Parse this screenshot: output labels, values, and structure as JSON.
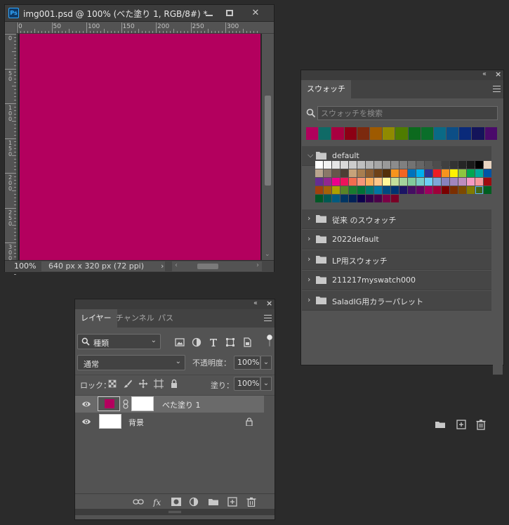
{
  "document": {
    "title": "img001.psd @ 100% (べた塗り 1, RGB/8#) *",
    "app_icon": "Ps",
    "fill_color": "#b3005e",
    "ruler_h_labels": [
      "0",
      "50",
      "100",
      "150",
      "200",
      "250",
      "300"
    ],
    "ruler_v_labels": [
      "0",
      "50",
      "100",
      "150",
      "200",
      "250",
      "300"
    ],
    "zoom": "100%",
    "doc_info": "640 px x 320 px (72 ppi)"
  },
  "swatches": {
    "tab_label": "スウォッチ",
    "search_placeholder": "スウォッチを検索",
    "recent": [
      "#b0005c",
      "#0f6a66",
      "#a80040",
      "#8c0014",
      "#7c2a0e",
      "#9e5a00",
      "#908a00",
      "#4e7c00",
      "#0c6a1e",
      "#0a6e2a",
      "#0a6a86",
      "#0c4e86",
      "#0a2a7a",
      "#14145a",
      "#4a0a6a"
    ],
    "groups": [
      {
        "name": "default",
        "expanded": true
      },
      {
        "name": "従来 のスウォッチ",
        "expanded": false
      },
      {
        "name": "2022default",
        "expanded": false
      },
      {
        "name": "LP用スウォッチ",
        "expanded": false
      },
      {
        "name": "211217myswatch000",
        "expanded": false
      },
      {
        "name": "SaladIG用カラーパレット",
        "expanded": false
      }
    ],
    "default_grid": [
      "#ffffff",
      "#f2f2f2",
      "#e6e6e6",
      "#d9d9d9",
      "#cccccc",
      "#bfbfbf",
      "#b3b3b3",
      "#a6a6a6",
      "#999999",
      "#8c8c8c",
      "#808080",
      "#737373",
      "#666666",
      "#595959",
      "#4d4d4d",
      "#404040",
      "#333333",
      "#262626",
      "#1a1a1a",
      "#000000",
      "#e8d4c0",
      "#b9a58e",
      "#8a7868",
      "#66564a",
      "#4c3e34",
      "#c7a37a",
      "#a87e50",
      "#8a5c30",
      "#6e4218",
      "#52300a",
      "#f7941d",
      "#f26522",
      "#0072bc",
      "#00aeef",
      "#2e3192",
      "#ed1c24",
      "#f7941d",
      "#fff200",
      "#8dc63f",
      "#00a651",
      "#00a99d",
      "#0054a6",
      "#662d91",
      "#92278f",
      "#ec008c",
      "#ed145b",
      "#f26c4f",
      "#f69679",
      "#fbaf5d",
      "#fdc689",
      "#fff799",
      "#c4df9b",
      "#a3d39c",
      "#82ca9c",
      "#7accc8",
      "#6dcff6",
      "#7ea7d8",
      "#8781bd",
      "#a186be",
      "#bd8cbf",
      "#f49ac2",
      "#f6989d",
      "#9e0b0f",
      "#a0410d",
      "#a36209",
      "#aba000",
      "#598527",
      "#197b30",
      "#007236",
      "#00746b",
      "#0076a3",
      "#004a80",
      "#003471",
      "#1b1464",
      "#440e62",
      "#630460",
      "#9e005d",
      "#9e0039",
      "#790000",
      "#7b2e00",
      "#7d4900",
      "#827b00",
      "#406618",
      "#005e20",
      "#005826",
      "#005952",
      "#005b7f",
      "#003663",
      "#002157",
      "#0d004c",
      "#32004b",
      "#4b0049",
      "#7b0046",
      "#7a0026"
    ],
    "selected_index": 82
  },
  "layers": {
    "tabs": [
      "レイヤー",
      "チャンネル",
      "パス"
    ],
    "filter_kind": "種類",
    "blend_mode": "通常",
    "opacity_label": "不透明度：",
    "opacity_value": "100%",
    "lock_label": "ロック：",
    "fill_label": "塗り：",
    "fill_value": "100%",
    "items": [
      {
        "name": "べた塗り 1",
        "selected": true,
        "thumb_color": "#b3005e",
        "locked": false
      },
      {
        "name": "背景",
        "selected": false,
        "thumb_color": "#ffffff",
        "locked": true
      }
    ]
  }
}
